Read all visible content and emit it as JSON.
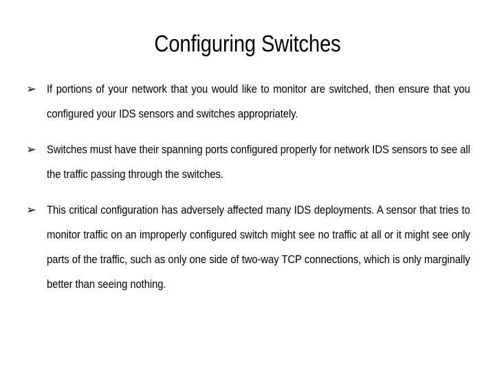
{
  "slide": {
    "title": "Configuring Switches",
    "bullet_marker": "➢",
    "background_color": "#ffffff",
    "text_color": "#000000",
    "bullets": [
      {
        "id": "bullet-1",
        "text": "If portions of your network that you would like to monitor are switched, then ensure that you configured your IDS sensors and switches appropriately."
      },
      {
        "id": "bullet-2",
        "text": "Switches must have their spanning ports configured properly for network IDS sensors to see all the traffic passing through the switches."
      },
      {
        "id": "bullet-3",
        "text": "This critical configuration has adversely affected many IDS deployments. A sensor that tries to monitor traffic on an improperly configured switch might see no traffic at all or it might see only parts of the traffic, such as only one side of two-way TCP connections, which is only marginally better than seeing nothing."
      }
    ]
  }
}
